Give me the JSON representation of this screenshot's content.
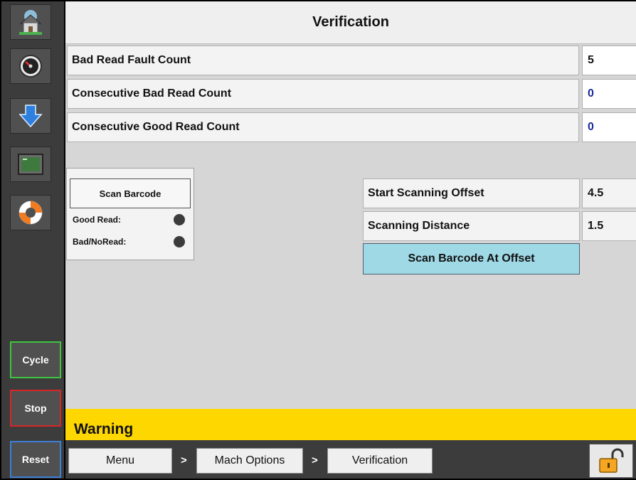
{
  "title": "Verification",
  "counts": [
    {
      "label": "Bad Read Fault Count",
      "value": "5",
      "value_color": "#111111"
    },
    {
      "label": "Consecutive Bad Read Count",
      "value": "0",
      "value_color": "#1a2a9a"
    },
    {
      "label": "Consecutive Good Read Count",
      "value": "0",
      "value_color": "#1a2a9a"
    }
  ],
  "scan_panel": {
    "button_label": "Scan Barcode",
    "good_read_label": "Good Read:",
    "bad_read_label": "Bad/NoRead:"
  },
  "offset": {
    "start_label": "Start Scanning Offset",
    "start_value": "4.5",
    "distance_label": "Scanning Distance",
    "distance_value": "1.5",
    "button_label": "Scan Barcode At Offset"
  },
  "warning_text": "Warning",
  "sidebar": {
    "icons": [
      "home-icon",
      "gauge-icon",
      "download-arrow-icon",
      "cpu-icon",
      "lifebuoy-icon"
    ],
    "cycle_label": "Cycle",
    "stop_label": "Stop",
    "reset_label": "Reset"
  },
  "breadcrumb": {
    "items": [
      "Menu",
      "Mach Options",
      "Verification"
    ],
    "separator": ">"
  },
  "colors": {
    "warning": "#ffd700",
    "accent_button": "#9fd9e6",
    "cycle_border": "#3ec43e",
    "stop_border": "#d62626",
    "reset_border": "#3c7fd6"
  }
}
